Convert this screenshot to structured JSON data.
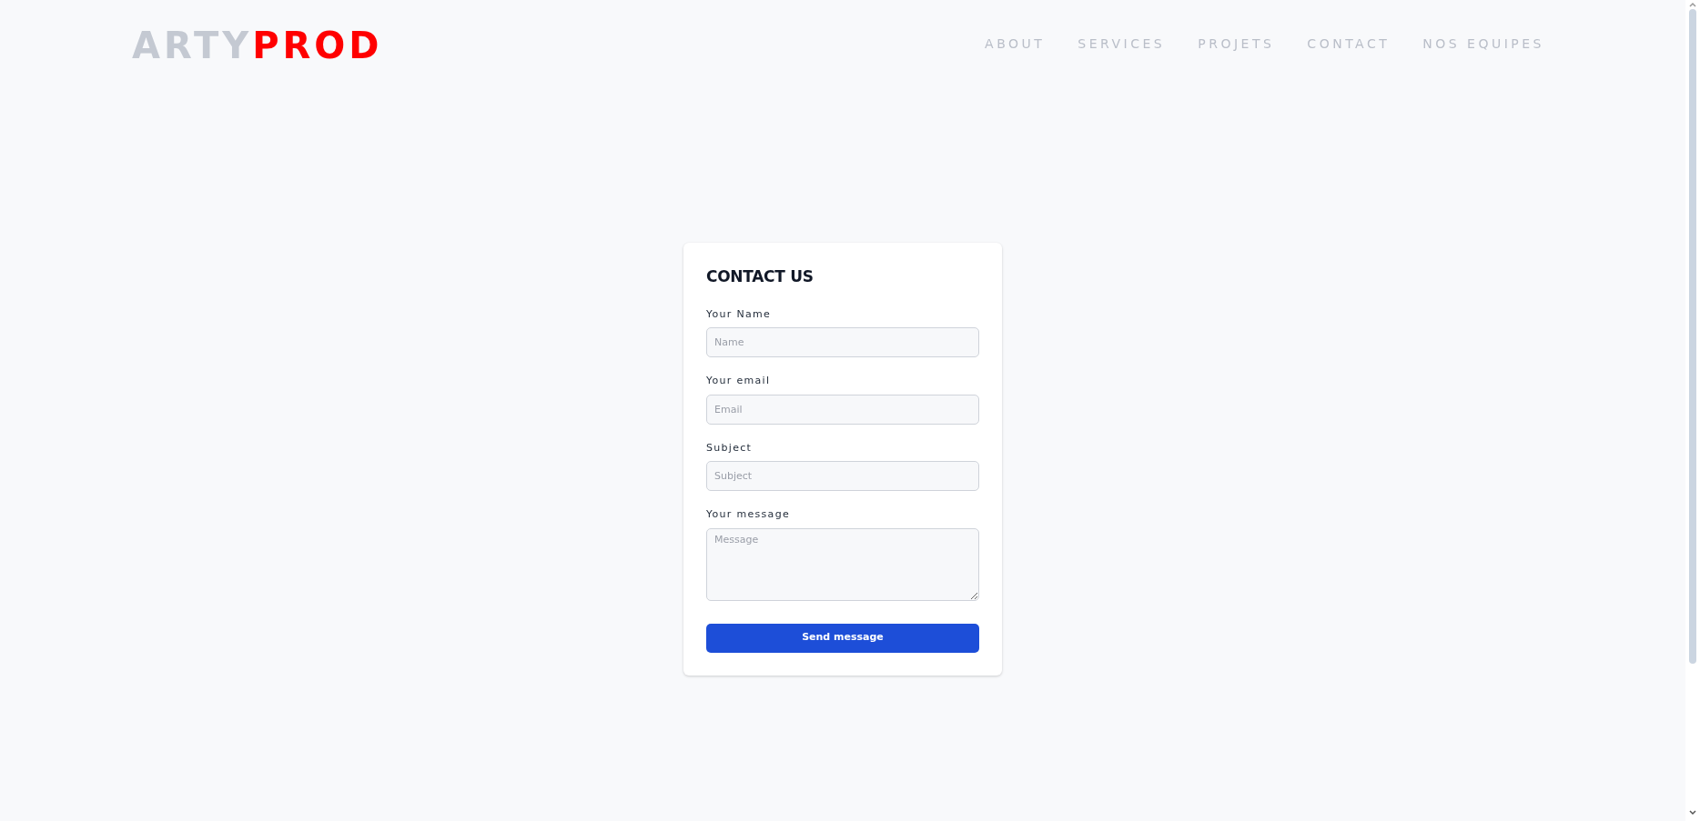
{
  "brand": {
    "part_1": "ARTY",
    "part_2": "PROD"
  },
  "nav": [
    "ABOUT",
    "SERVICES",
    "PROJETS",
    "CONTACT",
    "NOS EQUIPES"
  ],
  "form": {
    "title": "CONTACT US",
    "fields": [
      {
        "kind": "input",
        "label": "Your Name",
        "placeholder": "Name"
      },
      {
        "kind": "input",
        "label": "Your email",
        "placeholder": "Email"
      },
      {
        "kind": "input",
        "label": "Subject",
        "placeholder": "Subject"
      },
      {
        "kind": "textarea",
        "label": "Your message",
        "placeholder": "Message"
      }
    ],
    "button": "Send message"
  }
}
